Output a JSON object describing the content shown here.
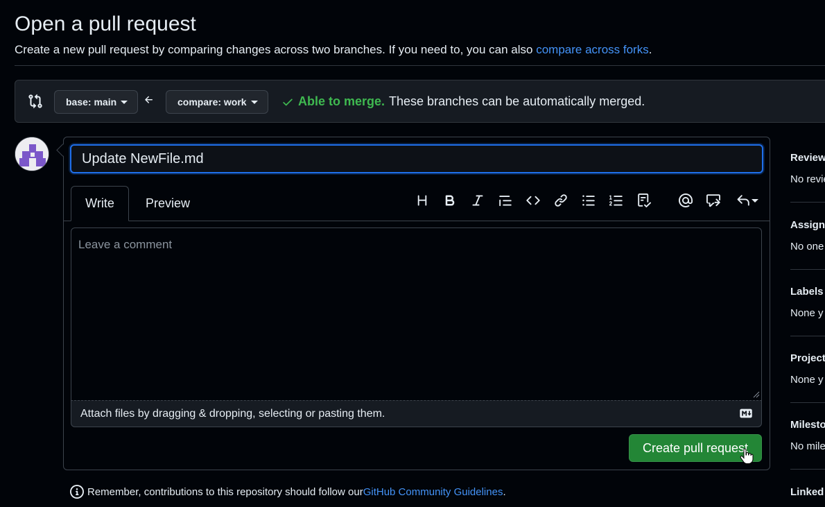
{
  "page": {
    "title": "Open a pull request",
    "subtitle_prefix": "Create a new pull request by comparing changes across two branches. If you need to, you can also ",
    "subtitle_link": "compare across forks",
    "subtitle_suffix": "."
  },
  "compare_bar": {
    "base_label": "base: main",
    "compare_label": "compare: work",
    "merge_ok": "Able to merge.",
    "merge_desc": "These branches can be automatically merged."
  },
  "form": {
    "title_value": "Update NewFile.md",
    "tabs": [
      {
        "label": "Write",
        "active": true
      },
      {
        "label": "Preview",
        "active": false
      }
    ],
    "toolbar_icons": [
      "heading-icon",
      "bold-icon",
      "italic-icon",
      "quote-icon",
      "code-icon",
      "link-icon",
      "unordered-list-icon",
      "ordered-list-icon",
      "task-list-icon",
      "mention-icon",
      "reference-icon",
      "reply-icon"
    ],
    "comment_placeholder": "Leave a comment",
    "attach_text": "Attach files by dragging & dropping, selecting or pasting them.",
    "submit_label": "Create pull request"
  },
  "note": {
    "prefix": "Remember, contributions to this repository should follow our ",
    "link": "GitHub Community Guidelines",
    "suffix": "."
  },
  "sidebar": [
    {
      "heading": "Reviewe",
      "value": "No revie"
    },
    {
      "heading": "Assigne",
      "value": "No one"
    },
    {
      "heading": "Labels",
      "value": "None y"
    },
    {
      "heading": "Projects",
      "value": "None y"
    },
    {
      "heading": "Milesto",
      "value": "No mile"
    },
    {
      "heading": "Linked",
      "value": ""
    }
  ],
  "colors": {
    "background": "#010409",
    "accent_link": "#4493f8",
    "success": "#3fb950",
    "button_green": "#238636",
    "focus_blue": "#1f6feb"
  }
}
